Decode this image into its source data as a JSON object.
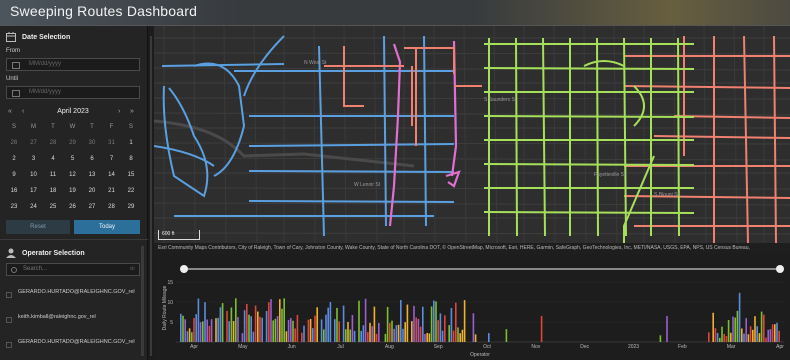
{
  "header": {
    "title": "Sweeping Routes Dashboard"
  },
  "date_selection": {
    "title": "Date Selection",
    "from_label": "From",
    "until_label": "Until",
    "from_placeholder": "MM/dd/yyyy",
    "until_placeholder": "MM/dd/yyyy",
    "month": "April 2023",
    "nav": {
      "prev_year": "«",
      "prev_month": "‹",
      "next_month": "›",
      "next_year": "»"
    },
    "weekdays": [
      "S",
      "M",
      "T",
      "W",
      "T",
      "F",
      "S"
    ],
    "weeks": [
      [
        "26",
        "27",
        "28",
        "29",
        "30",
        "31",
        "1"
      ],
      [
        "2",
        "3",
        "4",
        "5",
        "6",
        "7",
        "8"
      ],
      [
        "9",
        "10",
        "11",
        "12",
        "13",
        "14",
        "15"
      ],
      [
        "16",
        "17",
        "18",
        "19",
        "20",
        "21",
        "22"
      ],
      [
        "23",
        "24",
        "25",
        "26",
        "27",
        "28",
        "29"
      ]
    ],
    "reset_label": "Reset",
    "today_label": "Today"
  },
  "operator_selection": {
    "title": "Operator Selection",
    "search_placeholder": "Search...",
    "clear_label": "clr",
    "items": [
      "GERARDO.HURTADO@RALEIGHNC.GOV_rel",
      "keith.kimball@raleighnc.gov_rel",
      "GERARDO.HURTADO@RALEIGHNC.GOV_rel"
    ]
  },
  "map": {
    "scale_label": "600 ft",
    "attribution": "Esri Community Maps Contributors, City of Raleigh, Town of Cary, Johnston County, Wake County, State of North Carolina DOT, © OpenStreetMap, Microsoft, Esri, HERE, Garmin, SafeGraph, GeoTechnologies, Inc, METI/NASA, USGS, EPA, NPS, US Census Bureau,",
    "street_labels": [
      "N West St",
      "W Lenoir St",
      "S Saunders St",
      "Fayetteville St",
      "S Blount St"
    ],
    "route_colors": {
      "blue": "#5aa0e0",
      "salmon": "#f08070",
      "green": "#a6e05a",
      "pink": "#e070d0"
    }
  },
  "chart_data": {
    "type": "bar",
    "ylabel": "Daily Route Mileage",
    "xlabel": "Operator",
    "yticks": [
      "15",
      "10",
      "5"
    ],
    "ylim": [
      0,
      17
    ],
    "x_ticks": [
      "Apr",
      "May",
      "Jun",
      "Jul",
      "Aug",
      "Sep",
      "Oct",
      "Nov",
      "Dec",
      "2023",
      "Feb",
      "Mar",
      "Apr"
    ],
    "series_colors": [
      "#e0453a",
      "#5a8de0",
      "#f0b030",
      "#9a60d0",
      "#7ac030"
    ]
  }
}
